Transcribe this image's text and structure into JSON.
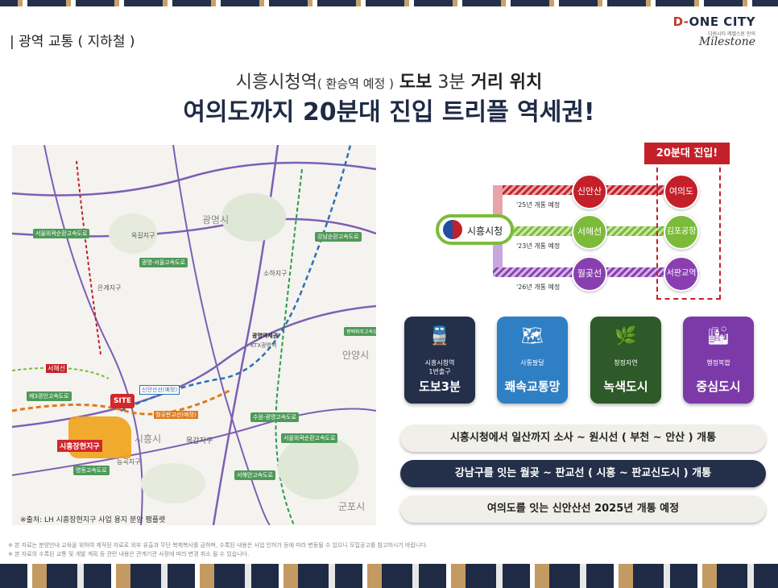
{
  "header": {
    "section_title": "| 광역 교통 ( 지하철 )",
    "logo_brand_a": "D-",
    "logo_brand_b": "ONE CITY",
    "logo_sub": "디원시티 레벨스톤 만의",
    "logo_script": "Milestone"
  },
  "headline": {
    "line1_a": "시흥시청역",
    "line1_b": "( 환승역 예정 )",
    "line1_c": "도보",
    "line1_d": "3분",
    "line1_e": "거리 위치",
    "line2": "여의도까지 20분대 진입 트리플 역세권!"
  },
  "map": {
    "site": "SITE",
    "site_zone": "시흥장현지구",
    "source": "※출처: LH 시흥장현지구 사업 용지 분양 팸플렛",
    "cities": [
      "광명시",
      "안양시",
      "시흥시",
      "군포시",
      "목감지구",
      "옥길지구",
      "은계지구",
      "소하지구",
      "능곡지구"
    ],
    "stations": [
      "광명역세권",
      "신안산선(예정)",
      "월곶판교선(예정)",
      "서해선",
      "KTX광명역"
    ],
    "roads": [
      "서울외곽순환고속도로",
      "광명-서울고속도로",
      "강남순환고속도로",
      "수원-광명고속도로",
      "제3경인고속도로",
      "영동고속도로",
      "서해안고속도로",
      "평택파주고속도로",
      "서울외곽순환고속도로"
    ]
  },
  "route": {
    "badge": "20분대 진입!",
    "origin": "시흥시청",
    "lines": [
      {
        "name": "신안산선",
        "dest": "여의도",
        "note": "'25년 개통 예정",
        "color": "#c4202a"
      },
      {
        "name": "서해선",
        "dest": "김포공항",
        "note": "'23년 개통 예정",
        "color": "#7cbb3a"
      },
      {
        "name": "월곶선",
        "dest": "서판교역",
        "note": "'26년 개통 예정",
        "color": "#8a3fb0"
      }
    ]
  },
  "cards": [
    {
      "icon": "train-icon",
      "glyph": "🚆",
      "small1": "시흥시청역",
      "small2": "1번출구",
      "big": "도보3분",
      "color": "#243049"
    },
    {
      "icon": "map-icon",
      "glyph": "🗺",
      "small1": "사통팔달",
      "small2": "",
      "big": "쾌속교통망",
      "color": "#2f7fc4"
    },
    {
      "icon": "leaf-icon",
      "glyph": "🌿",
      "small1": "청정자연",
      "small2": "",
      "big": "녹색도시",
      "color": "#2d5a28"
    },
    {
      "icon": "building-icon",
      "glyph": "🏙",
      "small1": "행정복합",
      "small2": "",
      "big": "중심도시",
      "color": "#7c3aa8"
    }
  ],
  "pills": [
    {
      "text": "시흥시청에서 일산까지 소사 ~ 원시선 ( 부천 ~ 안산 ) 개통",
      "bg": "#f0efe9",
      "fg": "#222"
    },
    {
      "text": "강남구를 잇는 월곶 ~ 판교선 ( 시흥 ~ 판교신도시 ) 개통",
      "bg": "#243049",
      "fg": "#ffffff"
    },
    {
      "text": "여의도를 잇는 신안산선 2025년 개통 예정",
      "bg": "#f0efe9",
      "fg": "#222"
    }
  ],
  "disclaimers": [
    "※ 본 자료는 분양안내 교육을 위하여 제작된 자료로 외부 유출과 무단 복제복사를 금하며, 수록된 내용은 사업 인허가 등에 따라 변동될 수 있으니 모집공고를 참고하시기 바랍니다.",
    "※ 본 자료의 수록된 교통 및 개발 계획 등 관련 내용은 관계기관 사정에 따라 변경 취소 될 수 있습니다."
  ]
}
